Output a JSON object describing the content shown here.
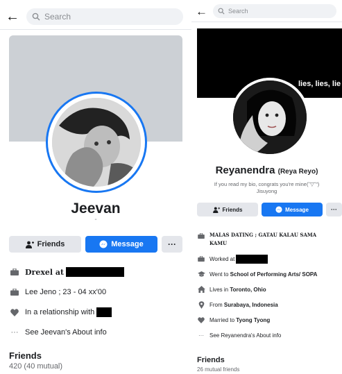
{
  "left": {
    "search_placeholder": "Search",
    "profile_name": "Jeevan",
    "name_dot": "-",
    "buttons": {
      "friends": "Friends",
      "message": "Message",
      "more": "···"
    },
    "info": {
      "work_prefix": "Drexel at",
      "birthday": "Lee Jeno ; 23 - 04 xx'00",
      "relationship_prefix": "In a relationship with",
      "about": "See Jeevan's About info"
    },
    "friends": {
      "title": "Friends",
      "count": "420 (40 mutual)"
    }
  },
  "right": {
    "search_placeholder": "Search",
    "cover_text": "lies, lies, lie",
    "profile_name": "Reyanendra",
    "profile_nickname": "(Reya Reyo)",
    "bio_line1": "If you read my bio, congrats you're mine(˘▽˘”)",
    "bio_line2": "Jisuyong",
    "buttons": {
      "friends": "Friends",
      "message": "Message",
      "more": "···"
    },
    "info": {
      "status_line1": "MALAS DATING ; GATAU KALAU SAMA",
      "status_line2": "KAMU",
      "worked_prefix": "Worked at",
      "went_prefix": "Went to ",
      "school": "School of Performing Arts/ SOPA",
      "lives_prefix": "Lives in ",
      "lives_city": "Toronto, Ohio",
      "from_prefix": "From ",
      "from_city": "Surabaya, Indonesia",
      "married_prefix": "Married to ",
      "married_name": "Tyong Tyong",
      "about": "See Reyanendra's About info"
    },
    "friends": {
      "title": "Friends",
      "count": "26 mutual friends"
    }
  },
  "colors": {
    "accent": "#1877f2",
    "button_gray": "#e4e6eb",
    "cover_gray": "#ccd0d5",
    "text_secondary": "#65676b"
  }
}
